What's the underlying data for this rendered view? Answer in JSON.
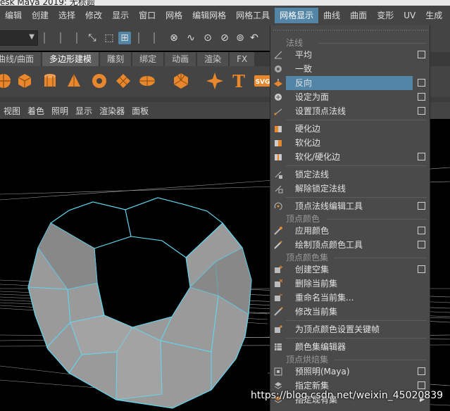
{
  "window": {
    "title": "esk Maya 2019: 无标题"
  },
  "menubar": {
    "items": [
      "编辑",
      "创建",
      "选择",
      "修改",
      "显示",
      "窗口",
      "网格",
      "编辑网格",
      "网格工具",
      "网格显示",
      "曲线",
      "曲面",
      "变形",
      "UV",
      "生成"
    ],
    "active": "网格显示"
  },
  "shelf_tabs": [
    "曲线/曲面",
    "多边形建模",
    "雕刻",
    "绑定",
    "动画",
    "渲染",
    "FX"
  ],
  "shelf_active": "多边形建模",
  "panel_menu": [
    "视图",
    "着色",
    "照明",
    "显示",
    "渲染器",
    "面板"
  ],
  "dropdown": {
    "sections": {
      "normals": "法线",
      "vertex_color": "顶点颜色",
      "vertex_color_set": "顶点颜色集",
      "vertex_bake_set": "顶点烘焙集"
    },
    "items": [
      {
        "label": "平均",
        "option": true,
        "icon": "normal-average-icon"
      },
      {
        "label": "一致",
        "option": false,
        "icon": "normal-conform-icon"
      },
      {
        "label": "反向",
        "option": true,
        "icon": "normal-reverse-icon",
        "highlighted": true
      },
      {
        "label": "设定为面",
        "option": true,
        "icon": "normal-set-to-face-icon"
      },
      {
        "label": "设置顶点法线",
        "option": true,
        "icon": "set-vertex-normal-icon"
      },
      {
        "label": "硬化边",
        "option": false,
        "icon": "harden-edge-icon"
      },
      {
        "label": "软化边",
        "option": false,
        "icon": "soften-edge-icon"
      },
      {
        "label": "软化/硬化边",
        "option": true,
        "icon": "soften-harden-edge-icon"
      },
      {
        "label": "锁定法线",
        "option": false,
        "icon": "lock-normals-icon"
      },
      {
        "label": "解除锁定法线",
        "option": false,
        "icon": "unlock-normals-icon"
      },
      {
        "label": "顶点法线编辑工具",
        "option": true,
        "icon": "vertex-normal-edit-tool-icon"
      },
      {
        "label": "应用颜色",
        "option": true,
        "icon": "apply-color-icon"
      },
      {
        "label": "绘制顶点颜色工具",
        "option": true,
        "icon": "paint-vertex-color-icon"
      },
      {
        "label": "创建空集",
        "option": true,
        "icon": "create-empty-set-icon"
      },
      {
        "label": "删除当前集",
        "option": false,
        "icon": "delete-current-set-icon"
      },
      {
        "label": "重命名当前集...",
        "option": false,
        "icon": "rename-current-set-icon"
      },
      {
        "label": "修改当前集",
        "option": false,
        "icon": "modify-current-set-icon"
      },
      {
        "label": "为顶点颜色设置关键帧",
        "option": false,
        "icon": "key-vertex-color-icon"
      },
      {
        "label": "颜色集编辑器",
        "option": false,
        "icon": "color-set-editor-icon"
      },
      {
        "label": "预照明(Maya)",
        "option": true,
        "icon": "prelight-icon"
      },
      {
        "label": "指定新集",
        "option": true,
        "icon": "assign-new-set-icon"
      },
      {
        "label": "指定现有集",
        "option": false,
        "submenu": true,
        "icon": "assign-existing-set-icon"
      }
    ]
  },
  "watermark": "https://blog.csdn.net/weixin_45020839",
  "colors": {
    "menu_bg": "#444444",
    "highlight": "#5285a6",
    "wire": "#5fd6f0",
    "mesh": "#9a9a9a"
  }
}
